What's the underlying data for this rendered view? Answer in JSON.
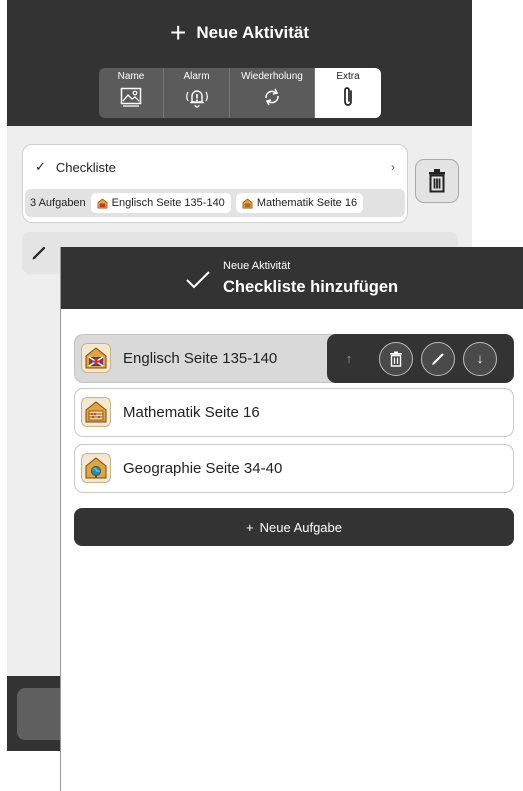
{
  "background": {
    "title": "Neue Aktivität",
    "tabs": [
      {
        "label": "Name",
        "icon": "image-icon"
      },
      {
        "label": "Alarm",
        "icon": "alarm-bell-icon"
      },
      {
        "label": "Wiederholung",
        "icon": "repeat-icon"
      },
      {
        "label": "Extra",
        "icon": "paperclip-icon",
        "active": true
      }
    ],
    "checklist": {
      "label": "Checkliste",
      "chevron": "›",
      "summary": "3 Aufgaben",
      "chips": [
        "Englisch Seite 135-140",
        "Mathematik Seite 16"
      ]
    }
  },
  "modal": {
    "subtitle": "Neue Aktivität",
    "title": "Checkliste hinzufügen",
    "tasks": [
      {
        "name": "Englisch Seite 135-140",
        "icon": "uk-flag-house-icon",
        "selected": true
      },
      {
        "name": "Mathematik Seite 16",
        "icon": "abacus-house-icon",
        "selected": false
      },
      {
        "name": "Geographie Seite 34-40",
        "icon": "globe-house-icon",
        "selected": false
      }
    ],
    "row_actions": {
      "move_up": "↑",
      "move_down": "↓"
    },
    "add_button": {
      "plus": "+",
      "label": "Neue Aufgabe"
    }
  },
  "colors": {
    "header": "#333333",
    "background": "#eeeeee",
    "selected_row": "#d9d9d9"
  }
}
